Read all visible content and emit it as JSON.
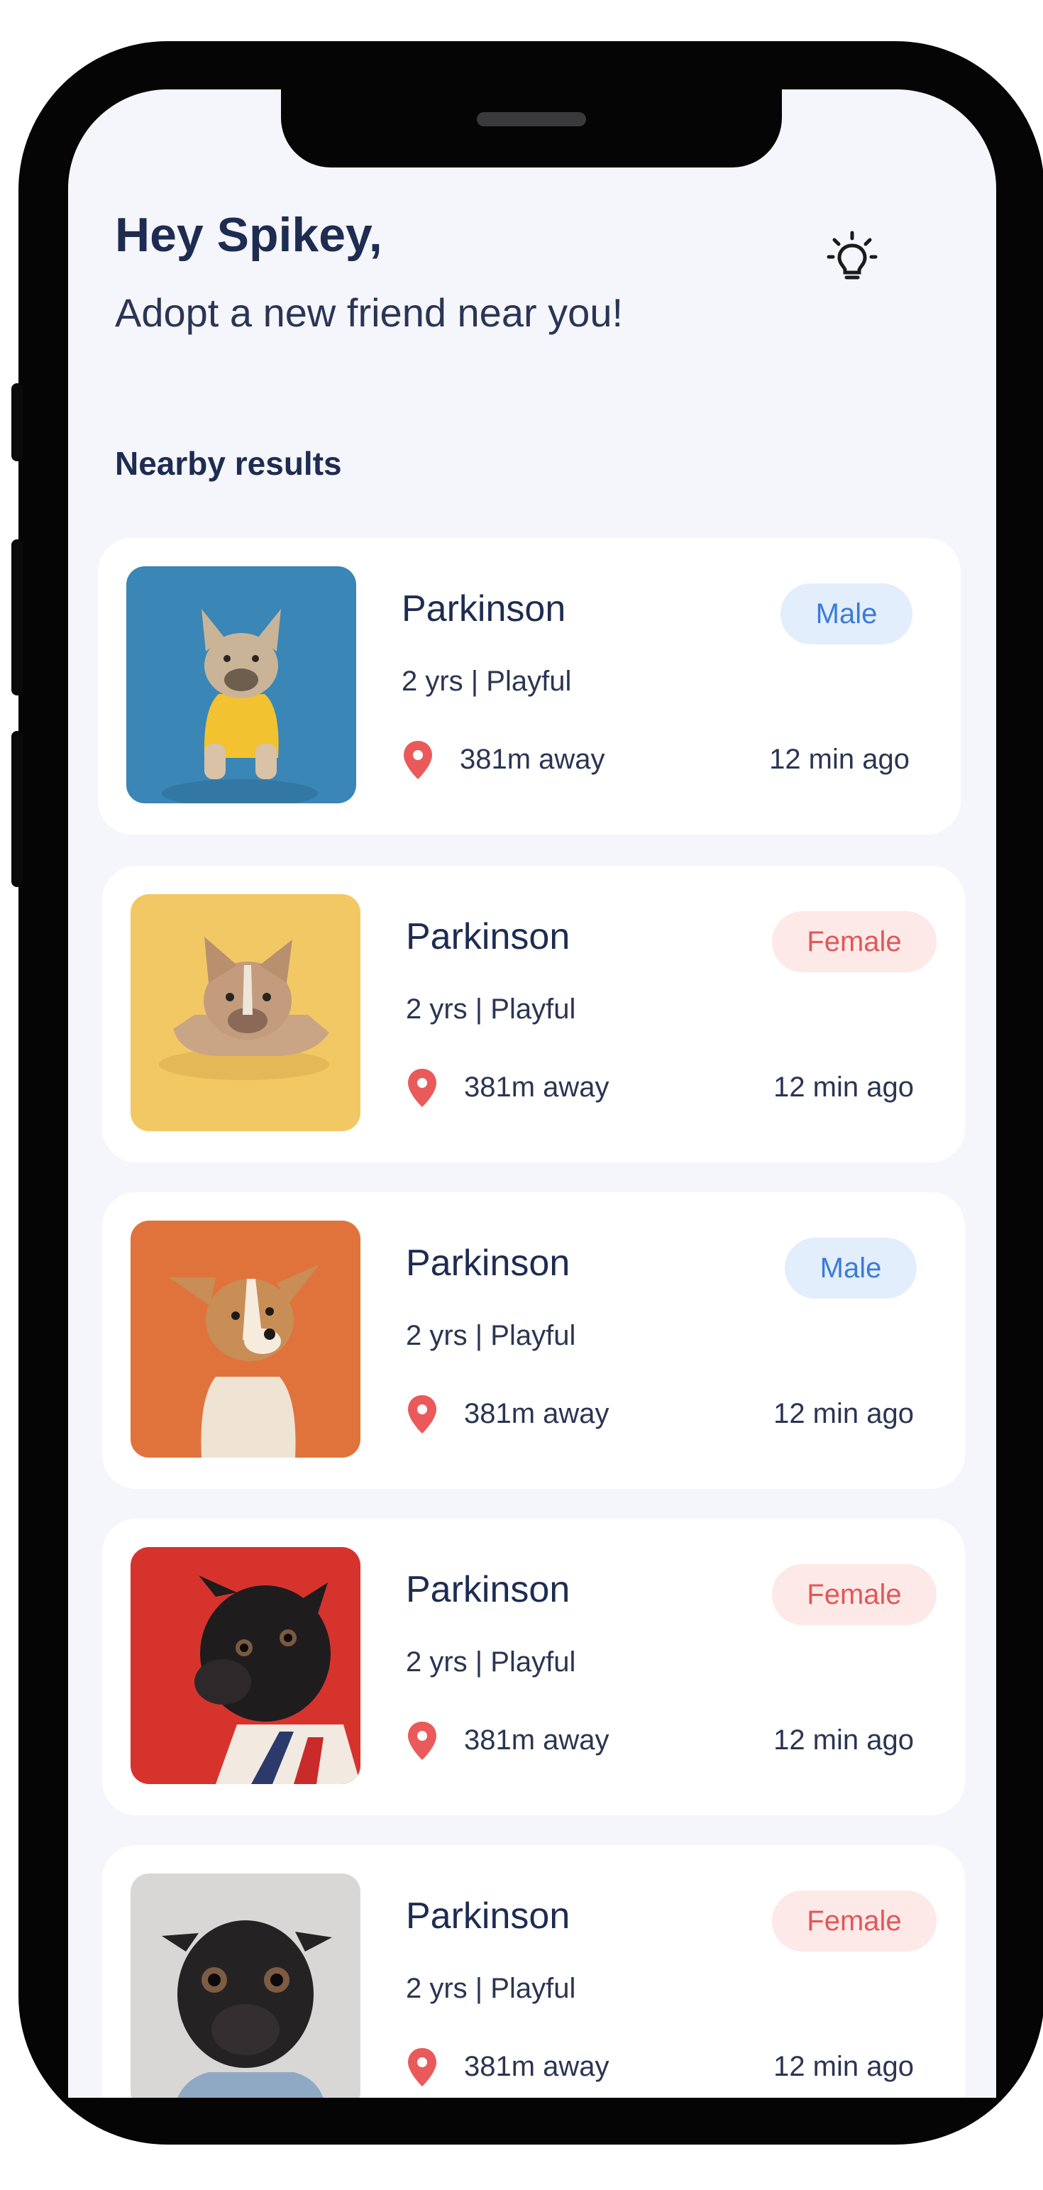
{
  "header": {
    "greeting": "Hey Spikey,",
    "subtitle": "Adopt a new friend near you!",
    "theme_icon": "lightbulb-icon"
  },
  "section_title": "Nearby results",
  "colors": {
    "background": "#f5f6fb",
    "text": "#1e2c52",
    "male_badge_bg": "#e3eefc",
    "male_badge_text": "#3a7bd8",
    "female_badge_bg": "#fde9e8",
    "female_badge_text": "#e25757",
    "pin": "#ea5a5a"
  },
  "pets": [
    {
      "name": "Parkinson",
      "gender": "Male",
      "details": "2 yrs | Playful",
      "distance": "381m away",
      "posted": "12 min ago",
      "photo": "french bulldog in yellow shirt on blue background"
    },
    {
      "name": "Parkinson",
      "gender": "Female",
      "details": "2 yrs | Playful",
      "distance": "381m away",
      "posted": "12 min ago",
      "photo": "french bulldog lying on yellow background"
    },
    {
      "name": "Parkinson",
      "gender": "Male",
      "details": "2 yrs | Playful",
      "distance": "381m away",
      "posted": "12 min ago",
      "photo": "corgi puppy on orange background"
    },
    {
      "name": "Parkinson",
      "gender": "Female",
      "details": "2 yrs | Playful",
      "distance": "381m away",
      "posted": "12 min ago",
      "photo": "black pug on red background"
    },
    {
      "name": "Parkinson",
      "gender": "Female",
      "details": "2 yrs | Playful",
      "distance": "381m away",
      "posted": "12 min ago",
      "photo": "black pug on grey background"
    }
  ]
}
